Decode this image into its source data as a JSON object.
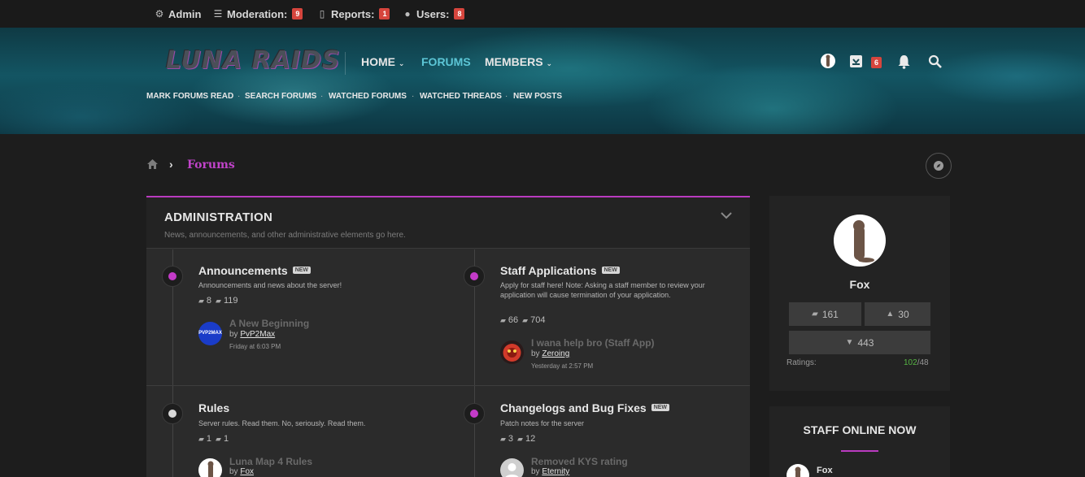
{
  "admin_bar": {
    "admin": "Admin",
    "moderation": "Moderation:",
    "moderation_count": "9",
    "reports": "Reports:",
    "reports_count": "1",
    "users": "Users:",
    "users_count": "8"
  },
  "header": {
    "logo": "LUNA RAIDS",
    "nav": [
      "HOME",
      "FORUMS",
      "MEMBERS"
    ],
    "active_nav": "FORUMS",
    "subnav": [
      "MARK FORUMS READ",
      "SEARCH FORUMS",
      "WATCHED FORUMS",
      "WATCHED THREADS",
      "NEW POSTS"
    ],
    "inbox_count": "6"
  },
  "breadcrumb": {
    "current": "Forums"
  },
  "category": {
    "title": "ADMINISTRATION",
    "description": "News, announcements, and other administrative elements go here."
  },
  "forums": [
    {
      "title": "Announcements",
      "new_tag": "NEW",
      "description": "Announcements and news about the server!",
      "threads": "8",
      "messages": "119",
      "last_title": "A New Beginning",
      "last_by_prefix": "by",
      "last_by": "PvP2Max",
      "last_time": "Friday at 6:03 PM",
      "dot_color": "#c43bc8"
    },
    {
      "title": "Staff Applications",
      "new_tag": "NEW",
      "description": "Apply for staff here! Note: Asking a staff member to review your application will cause termination of your application.",
      "threads": "66",
      "messages": "704",
      "last_title": "I wana help bro (Staff App)",
      "last_by_prefix": "by",
      "last_by": "Zeroing",
      "last_time": "Yesterday at 2:57 PM",
      "dot_color": "#c43bc8"
    },
    {
      "title": "Rules",
      "description": "Server rules. Read them. No, seriously. Read them.",
      "threads": "1",
      "messages": "1",
      "last_title": "Luna Map 4 Rules",
      "last_by_prefix": "by",
      "last_by": "Fox",
      "dot_color": "#d8d8d8"
    },
    {
      "title": "Changelogs and Bug Fixes",
      "new_tag": "NEW",
      "description": "Patch notes for the server",
      "threads": "3",
      "messages": "12",
      "last_title": "Removed KYS rating",
      "last_by_prefix": "by",
      "last_by": "Eternity",
      "dot_color": "#c43bc8"
    }
  ],
  "sidebar": {
    "username": "Fox",
    "messages": "161",
    "likes": "30",
    "trophies": "443",
    "ratings_label": "Ratings:",
    "ratings_positive": "102",
    "ratings_total": "/48"
  },
  "staff_online": {
    "title": "STAFF ONLINE NOW",
    "members": [
      "Fox"
    ]
  },
  "avatar_texts": {
    "pvp2max": "PVP2MAX"
  }
}
